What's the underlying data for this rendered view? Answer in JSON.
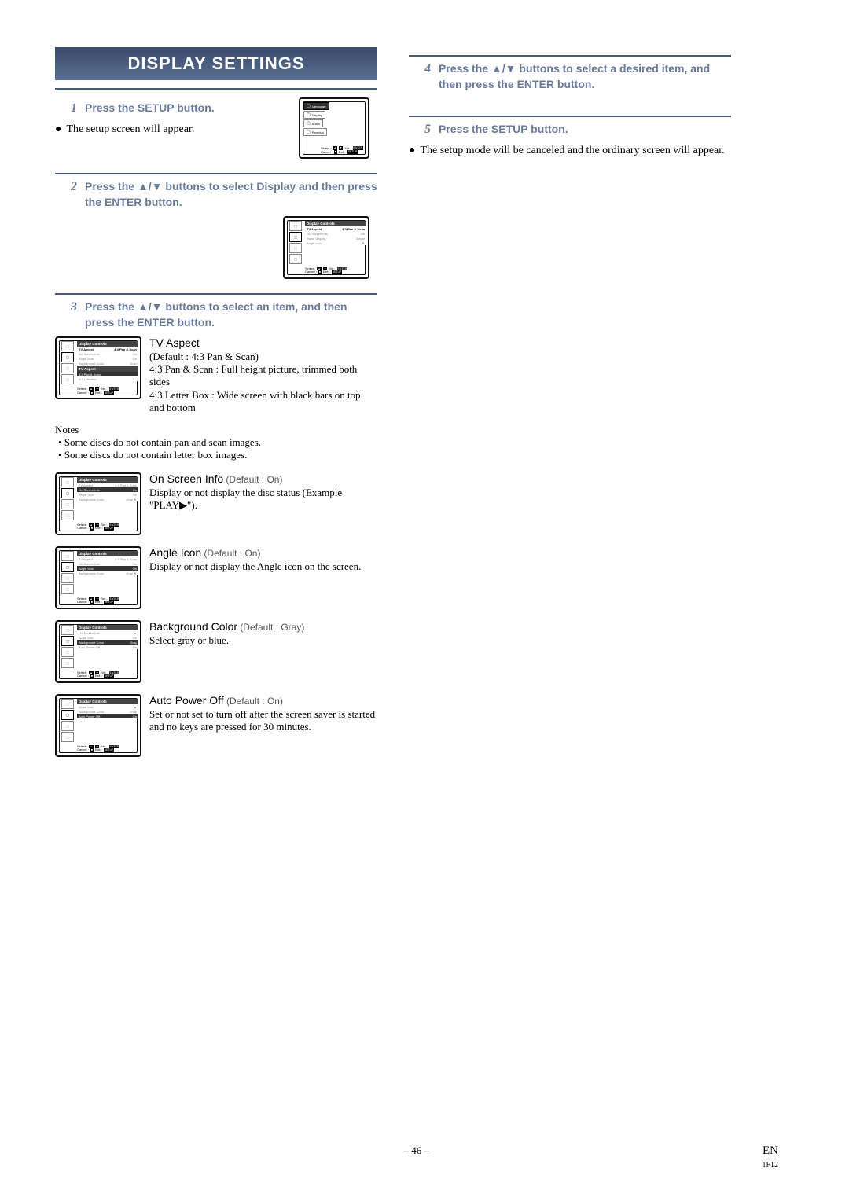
{
  "title": "DISPLAY SETTINGS",
  "steps": {
    "s1": {
      "num": "1",
      "text": "Press the SETUP button."
    },
    "s1_bullet": "The setup screen will appear.",
    "s2": {
      "num": "2",
      "text_a": "Press the ",
      "text_b": " buttons to select Display and then press the ENTER button."
    },
    "s3": {
      "num": "3",
      "text_a": "Press the ",
      "text_b": " buttons to select an item, and then press the ENTER button."
    },
    "s4": {
      "num": "4",
      "text_a": "Press the ",
      "text_b": " buttons to select a desired item, and then press the ENTER button."
    },
    "s5": {
      "num": "5",
      "text": "Press the SETUP button."
    },
    "s5_bullet": "The setup mode will be canceled and the ordinary screen will appear."
  },
  "tv_aspect": {
    "heading": "TV Aspect",
    "default": "(Default : 4:3 Pan & Scan)",
    "line1": "4:3 Pan & Scan : Full height picture, trimmed both sides",
    "line2": "4:3 Letter Box : Wide screen with black bars on top and bottom"
  },
  "notes": {
    "heading": "Notes",
    "n1": "Some discs do not contain pan and scan images.",
    "n2": "Some discs do not contain letter box images."
  },
  "onscreen": {
    "heading": "On Screen Info",
    "default": "(Default : On)",
    "line1": "Display or not display the disc status (Example \"PLAY▶\")."
  },
  "angle": {
    "heading": "Angle Icon",
    "default": "(Default : On)",
    "line1": "Display or not display the Angle icon on the screen."
  },
  "bgcolor": {
    "heading": "Background Color",
    "default": "(Default : Gray)",
    "line1": "Select gray or blue."
  },
  "autopower": {
    "heading": "Auto Power Off",
    "default": "(Default : On)",
    "line1": "Set or not set to turn off after the screen saver is started and no keys are pressed for 30 minutes."
  },
  "thumb_setup": {
    "items": [
      "Language",
      "Display",
      "Audio",
      "Parental"
    ],
    "sel": "Select :",
    "set": "Set :",
    "enter": "ENTER",
    "can": "Cancel :",
    "exit": "Exit :",
    "setup": "SETUP"
  },
  "thumb_display": {
    "header": "Display Controls",
    "rows": [
      {
        "l": "TV Aspect",
        "r": "4:3 Pan & Scan"
      },
      {
        "l": "On Screen Info",
        "r": "On"
      },
      {
        "l": "Panel Display",
        "r": "Bright"
      },
      {
        "l": "Angle Icon",
        "r": "On"
      }
    ],
    "sub_header": "TV Aspect",
    "sub_rows": [
      "4:3 Pan & Scan",
      "4:3 Letterbox"
    ],
    "rows_bg": [
      {
        "l": "On Screen Info",
        "r": "On"
      },
      {
        "l": "Angle Icon",
        "r": "On"
      },
      {
        "l": "Background Color",
        "r": "Gray"
      },
      {
        "l": "Auto Power Off",
        "r": "On"
      }
    ],
    "rows_ap": [
      {
        "l": "Angle Icon",
        "r": "On"
      },
      {
        "l": "Background Color",
        "r": "Gray"
      },
      {
        "l": "Auto Power Off",
        "r": "On"
      }
    ],
    "sel": "Select :",
    "set": "Set :",
    "enter": "ENTER",
    "can": "Cancel :",
    "exit": "Exit :",
    "setup": "SETUP"
  },
  "footer": {
    "page": "– 46 –",
    "en": "EN",
    "code": "1F12"
  },
  "arrows": "▲/▼"
}
